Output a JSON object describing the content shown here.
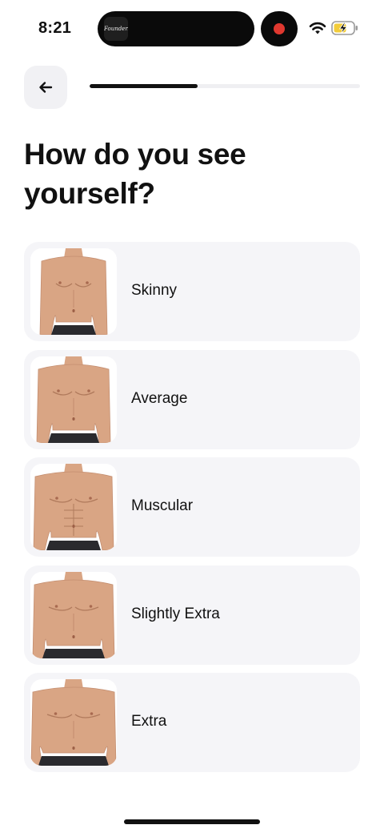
{
  "status_bar": {
    "time": "8:21",
    "island_app_label": "Founders",
    "recording_color": "#e0382f",
    "icons": [
      "wifi-icon",
      "battery-charging-icon"
    ]
  },
  "header": {
    "back_icon": "arrow-left-icon",
    "progress": 0.4
  },
  "title": "How do you see yourself?",
  "options": [
    {
      "label": "Skinny",
      "icon": "body-skinny-image"
    },
    {
      "label": "Average",
      "icon": "body-average-image"
    },
    {
      "label": "Muscular",
      "icon": "body-muscular-image"
    },
    {
      "label": "Slightly Extra",
      "icon": "body-slightly-extra-image"
    },
    {
      "label": "Extra",
      "icon": "body-extra-image"
    }
  ],
  "colors": {
    "accent": "#111111",
    "card_background": "#f5f5f8",
    "progress_track": "#efeff2",
    "skin": "#d9a584",
    "shorts": "#2a2a2e"
  }
}
